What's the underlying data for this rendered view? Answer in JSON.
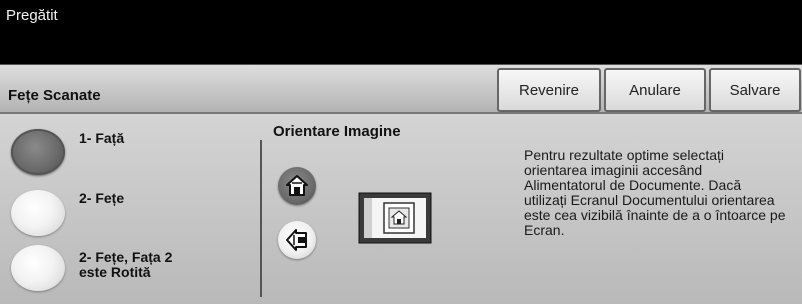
{
  "status": {
    "text": "Pregătit"
  },
  "panel": {
    "title": "Fețe Scanate"
  },
  "buttons": {
    "back": "Revenire",
    "cancel": "Anulare",
    "save": "Salvare"
  },
  "options": [
    {
      "label": "1- Față",
      "selected": true
    },
    {
      "label": "2- Fețe",
      "selected": false
    },
    {
      "label": "2- Fețe, Fața 2\neste Rotită",
      "selected": false
    }
  ],
  "orientation": {
    "title": "Orientare Imagine",
    "upright_icon": "upright-house-icon",
    "rotated_icon": "rotated-house-icon",
    "preview_icon": "document-feeder-icon"
  },
  "help": {
    "text": "Pentru rezultate optime selectați orientarea imaginii accesând Alimentatorul de Documente. Dacă utilizați Ecranul Documentului orientarea este cea vizibilă înainte de a o întoarce pe Ecran."
  }
}
